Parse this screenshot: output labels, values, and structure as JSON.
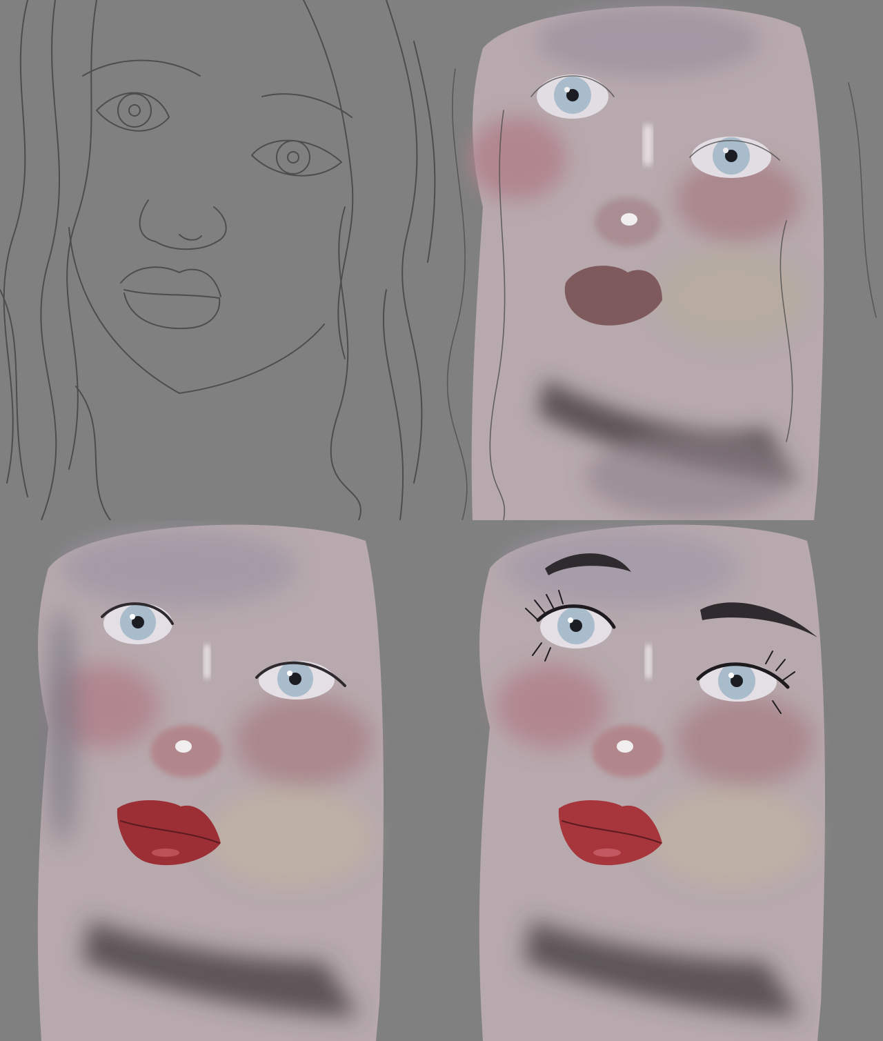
{
  "colors": {
    "background": "#808080",
    "sketch_line": "#4d4d4d",
    "skin_base": "#b7a9ad",
    "skin_shadow": "#8d8088",
    "neck_shadow": "#4e4448",
    "blush": "#b0808a",
    "iris": "#a9bccb",
    "pupil": "#1b1d22",
    "lip_flat": "#7e5a5c",
    "lip_red": "#9c2f35",
    "highlight": "#f1eef0",
    "brow": "#2e2a2e"
  },
  "panels": [
    {
      "stage": "sketch"
    },
    {
      "stage": "flat-color"
    },
    {
      "stage": "rendering"
    },
    {
      "stage": "details"
    }
  ]
}
